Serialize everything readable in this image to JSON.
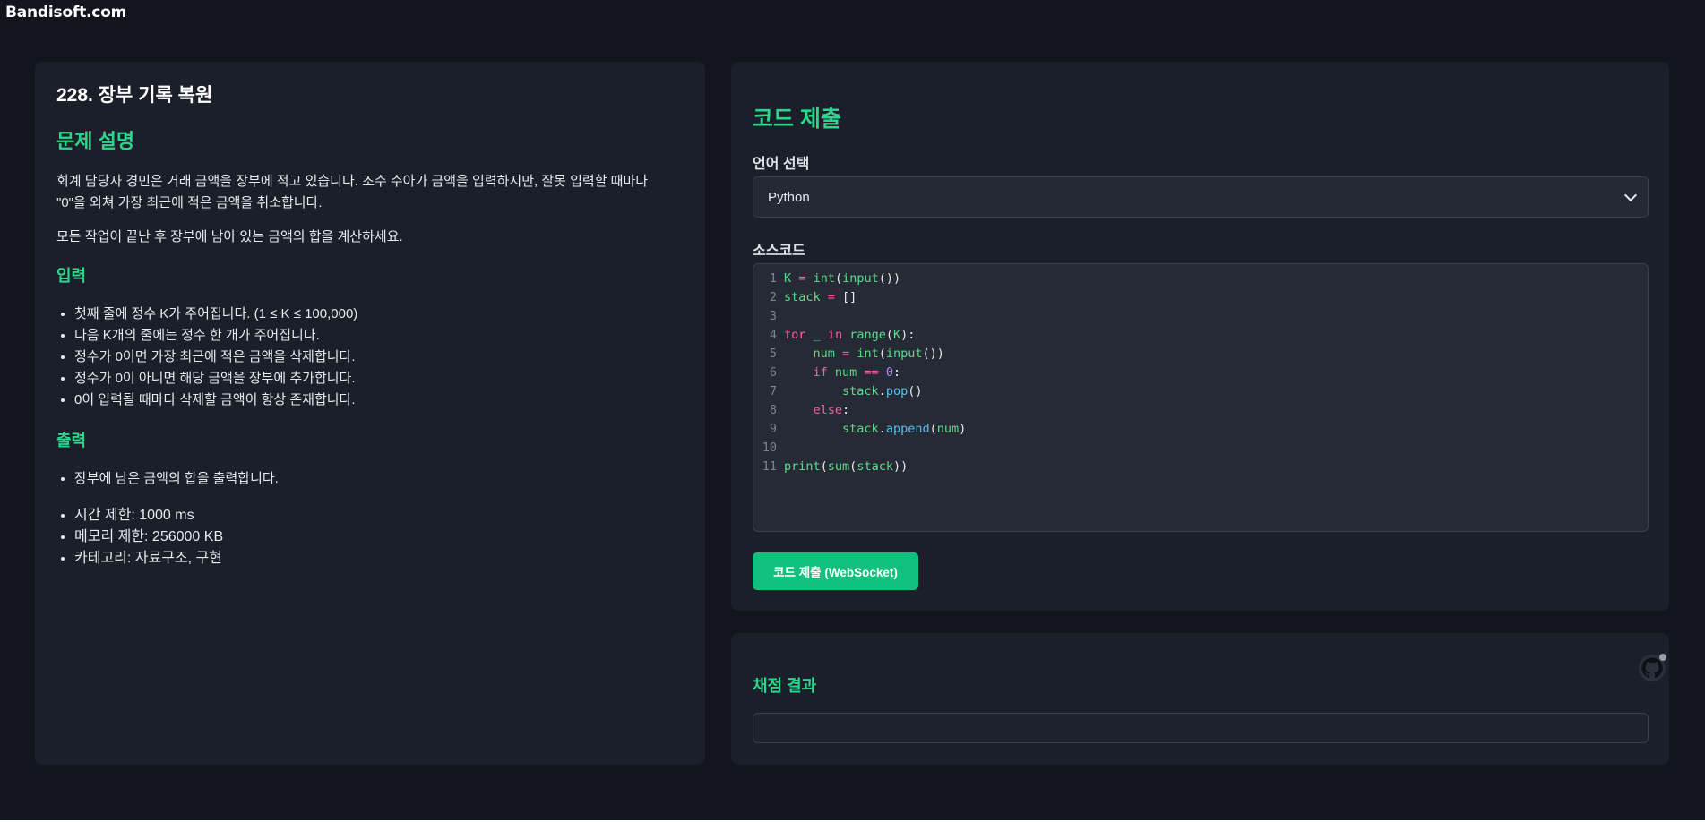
{
  "watermark": "Bandisoft.com",
  "problem": {
    "title": "228. 장부 기록 복원",
    "description_heading": "문제 설명",
    "description_paragraphs": [
      "회계 담당자 경민은 거래 금액을 장부에 적고 있습니다. 조수 수아가 금액을 입력하지만, 잘못 입력할 때마다 \"0\"을 외쳐 가장 최근에 적은 금액을 취소합니다.",
      "모든 작업이 끝난 후 장부에 남아 있는 금액의 합을 계산하세요."
    ],
    "input_heading": "입력",
    "input_items": [
      "첫째 줄에 정수 K가 주어집니다. (1 ≤ K ≤ 100,000)",
      "다음 K개의 줄에는 정수 한 개가 주어집니다.",
      "정수가 0이면 가장 최근에 적은 금액을 삭제합니다.",
      "정수가 0이 아니면 해당 금액을 장부에 추가합니다.",
      "0이 입력될 때마다 삭제할 금액이 항상 존재합니다."
    ],
    "output_heading": "출력",
    "output_items": [
      "장부에 남은 금액의 합을 출력합니다."
    ],
    "meta_items": [
      "시간 제한: 1000 ms",
      "메모리 제한: 256000 KB",
      "카테고리: 자료구조, 구현"
    ]
  },
  "submit": {
    "heading": "코드 제출",
    "language_label": "언어 선택",
    "language_value": "Python",
    "source_label": "소스코드",
    "button_label": "코드 제출 (WebSocket)",
    "code_lines": [
      "K = int(input())",
      "stack = []",
      "",
      "for _ in range(K):",
      "    num = int(input())",
      "    if num == 0:",
      "        stack.pop()",
      "    else:",
      "        stack.append(num)",
      "",
      "print(sum(stack))"
    ]
  },
  "result": {
    "heading": "채점 결과",
    "content": ""
  },
  "icons": {
    "corner_icon": "github-icon",
    "select_arrow": "chevron-down-icon"
  },
  "colors": {
    "accent": "#2bd68b",
    "button": "#10c07d",
    "background": "#12151e",
    "panel": "#1b1f2a"
  }
}
